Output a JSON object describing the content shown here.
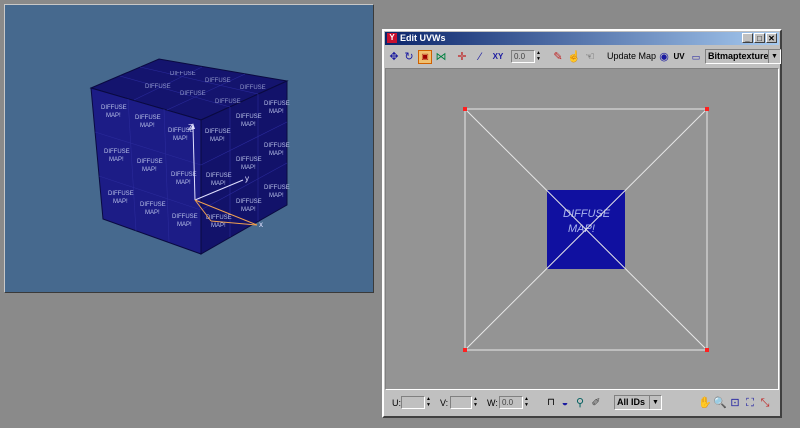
{
  "viewport": {
    "cube_tile_lines": [
      "DIFFUSE",
      "MAP!"
    ],
    "axis_labels": {
      "z": "Z",
      "y": "y",
      "x": "x"
    },
    "colors": {
      "background": "#46698e",
      "cube_front": "#1c1c86",
      "cube_side": "#10105e",
      "cube_top": "#14146e"
    }
  },
  "uvw_window": {
    "title": "Edit UVWs",
    "window_buttons": {
      "minimize": "_",
      "maximize": "□",
      "close": "✕"
    },
    "toolbar_top": {
      "icons": [
        "move-icon",
        "rotate-icon",
        "scale-icon",
        "mirror-icon",
        "falloff-icon",
        "brush-icon",
        "xy-icon",
        "pick-icon",
        "snap-icon",
        "lock-icon"
      ],
      "falloff_value": "0.0",
      "update_map_label": "Update Map",
      "uv_label": "UV",
      "texture_select": "Bitmaptexture"
    },
    "canvas": {
      "texture_lines": [
        "DIFFUSE",
        "MAP!"
      ],
      "colors": {
        "background": "#949494",
        "texture": "#1010a0",
        "edge": "#e8e8e8",
        "vertex": "#ff2020"
      }
    },
    "toolbar_bottom": {
      "u_label": "U:",
      "v_label": "V:",
      "w_label": "W:",
      "u_value": "",
      "v_value": "",
      "w_value": "0.0",
      "id_select": "All IDs"
    }
  }
}
